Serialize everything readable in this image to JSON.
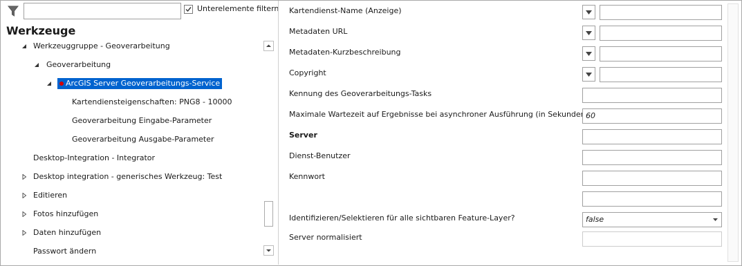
{
  "filter": {
    "icon": "funnel-icon",
    "input_value": "",
    "checkbox_label": "Unterelemente filtern",
    "checkbox_checked": true
  },
  "tools_heading": "Werkzeuge",
  "tree": [
    {
      "label": "Werkzeuggruppe - Geoverarbeitung",
      "toggle": "expanded"
    },
    {
      "label": "Geoverarbeitung",
      "toggle": "expanded"
    },
    {
      "label": "ArcGIS Server Geoverarbeitungs-Service",
      "toggle": "expanded",
      "selected": true
    },
    {
      "label": "Kartendiensteigenschaften: PNG8 - 10000",
      "toggle": "none"
    },
    {
      "label": "Geoverarbeitung Eingabe-Parameter",
      "toggle": "none"
    },
    {
      "label": "Geoverarbeitung Ausgabe-Parameter",
      "toggle": "none"
    },
    {
      "label": "Desktop-Integration - Integrator",
      "toggle": "none"
    },
    {
      "label": "Desktop integration - generisches Werkzeug: Test",
      "toggle": "collapsed"
    },
    {
      "label": "Editieren",
      "toggle": "collapsed"
    },
    {
      "label": "Fotos hinzufügen",
      "toggle": "collapsed"
    },
    {
      "label": "Daten hinzufügen",
      "toggle": "collapsed"
    },
    {
      "label": "Passwort ändern",
      "toggle": "none"
    }
  ],
  "properties": [
    {
      "label": "Kartendienst-Name (Anzeige)",
      "value": ""
    },
    {
      "label": "Metadaten URL",
      "value": ""
    },
    {
      "label": "Metadaten-Kurzbeschreibung",
      "value": ""
    },
    {
      "label": "Copyright",
      "value": ""
    },
    {
      "label": "Kennung des Geoverarbeitungs-Tasks",
      "value": ""
    },
    {
      "label": "Maximale Wartezeit auf Ergebnisse bei asynchroner Ausführung (in Sekunden)",
      "value": "60"
    },
    {
      "label": "Server",
      "value": ""
    },
    {
      "label": "Dienst-Benutzer",
      "value": ""
    },
    {
      "label": "Kennwort",
      "value": ""
    },
    {
      "label": "",
      "value": ""
    },
    {
      "label": "Identifizieren/Selektieren für alle sichtbaren Feature-Layer?",
      "value": "false"
    },
    {
      "label": "Server normalisiert",
      "value": ""
    }
  ],
  "colors": {
    "selection": "#0063cf",
    "marker": "#d40000",
    "border": "#a0a0a0"
  }
}
